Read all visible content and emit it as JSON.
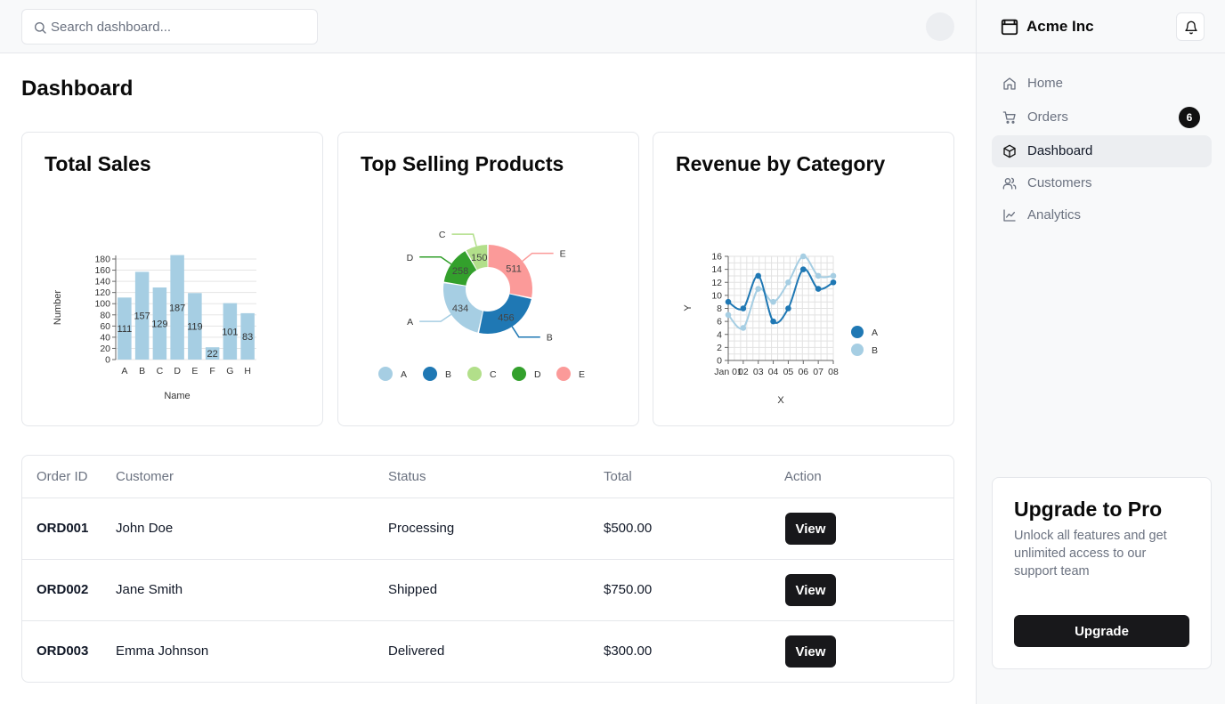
{
  "search": {
    "placeholder": "Search dashboard..."
  },
  "page": {
    "title": "Dashboard"
  },
  "cards": {
    "total_sales": {
      "title": "Total Sales"
    },
    "top_selling": {
      "title": "Top Selling Products"
    },
    "revenue": {
      "title": "Revenue by Category"
    }
  },
  "chart_data": [
    {
      "type": "bar",
      "title": "Total Sales",
      "xlabel": "Name",
      "ylabel": "Number",
      "categories": [
        "A",
        "B",
        "C",
        "D",
        "E",
        "F",
        "G",
        "H"
      ],
      "values": [
        111,
        157,
        129,
        187,
        119,
        22,
        101,
        83
      ],
      "ylim": [
        0,
        180
      ],
      "yticks": [
        0,
        20,
        40,
        60,
        80,
        100,
        120,
        140,
        160,
        180
      ],
      "grid": true,
      "color": "#a6cee3"
    },
    {
      "type": "pie",
      "variant": "donut",
      "title": "Top Selling Products",
      "labels": [
        "A",
        "B",
        "C",
        "D",
        "E"
      ],
      "values": [
        434,
        456,
        150,
        258,
        511
      ],
      "colors": [
        "#a6cee3",
        "#1f78b4",
        "#b2df8a",
        "#33a02c",
        "#fb9a99"
      ],
      "legend": "bottom"
    },
    {
      "type": "line",
      "title": "Revenue by Category",
      "xlabel": "X",
      "ylabel": "Y",
      "x": [
        "Jan 01",
        "02",
        "03",
        "04",
        "05",
        "06",
        "07",
        "08"
      ],
      "x_tick_labels_rendered": "Jan 01 02 03 04 05 06 07 08 (overlapping)",
      "series": [
        {
          "name": "A",
          "color": "#1f78b4",
          "values": [
            9,
            8,
            13,
            6,
            8,
            14,
            11,
            12
          ]
        },
        {
          "name": "B",
          "color": "#a6cee3",
          "values": [
            7,
            5,
            11,
            9,
            12,
            16,
            13,
            13
          ]
        }
      ],
      "ylim": [
        0,
        16
      ],
      "yticks": [
        0,
        2,
        4,
        6,
        8,
        10,
        12,
        14,
        16
      ],
      "grid": true,
      "legend": "right"
    }
  ],
  "table": {
    "headers": [
      "Order ID",
      "Customer",
      "Status",
      "Total",
      "Action"
    ],
    "rows": [
      {
        "id": "ORD001",
        "customer": "John Doe",
        "status": "Processing",
        "total": "$500.00",
        "action": "View"
      },
      {
        "id": "ORD002",
        "customer": "Jane Smith",
        "status": "Shipped",
        "total": "$750.00",
        "action": "View"
      },
      {
        "id": "ORD003",
        "customer": "Emma Johnson",
        "status": "Delivered",
        "total": "$300.00",
        "action": "View"
      }
    ]
  },
  "sidebar": {
    "brand": "Acme Inc",
    "brand_icon": "package-icon",
    "items": [
      {
        "label": "Home",
        "icon": "home-icon",
        "active": false
      },
      {
        "label": "Orders",
        "icon": "cart-icon",
        "badge": "6",
        "active": false
      },
      {
        "label": "Dashboard",
        "icon": "package-icon",
        "active": true
      },
      {
        "label": "Customers",
        "icon": "users-icon",
        "active": false
      },
      {
        "label": "Analytics",
        "icon": "line-chart-icon",
        "active": false
      }
    ],
    "upgrade": {
      "title": "Upgrade to Pro",
      "text": "Unlock all features and get unlimited access to our support team",
      "button": "Upgrade"
    }
  }
}
